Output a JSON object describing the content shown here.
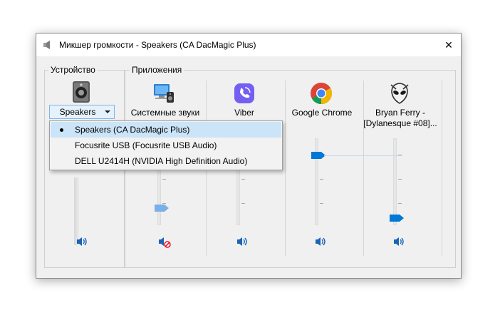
{
  "window": {
    "title": "Микшер громкости - Speakers (CA DacMagic Plus)",
    "title_icon": "speaker-icon",
    "close_glyph": "✕"
  },
  "groups": {
    "device_label": "Устройство",
    "apps_label": "Приложения"
  },
  "device": {
    "selected": "Speakers",
    "icon": "speaker-device-icon",
    "volume_level": 0.5,
    "muted": false
  },
  "dropdown": {
    "items": [
      {
        "label": "Speakers (CA DacMagic Plus)",
        "selected": true
      },
      {
        "label": "Focusrite USB (Focusrite USB Audio)",
        "selected": false
      },
      {
        "label": "DELL U2414H (NVIDIA High Definition Audio)",
        "selected": false
      }
    ]
  },
  "apps": [
    {
      "label": "Системные звуки",
      "label2": "",
      "icon": "system-sounds-icon",
      "volume_level": 0.2,
      "muted": true
    },
    {
      "label": "Viber",
      "label2": "",
      "icon": "viber-icon",
      "volume_level": 0.6,
      "muted": false
    },
    {
      "label": "Google Chrome",
      "label2": "",
      "icon": "chrome-icon",
      "volume_level": 1.0,
      "muted": false
    },
    {
      "label": "Bryan Ferry -",
      "label2": "[Dylanesque #08]...",
      "icon": "foobar-alien-icon",
      "volume_level": 0.1,
      "muted": false
    }
  ],
  "colors": {
    "accent": "#0078d7",
    "thumb_inactive": "#79b0e6",
    "mute_red": "#e81123",
    "selection": "#cce4f7"
  }
}
